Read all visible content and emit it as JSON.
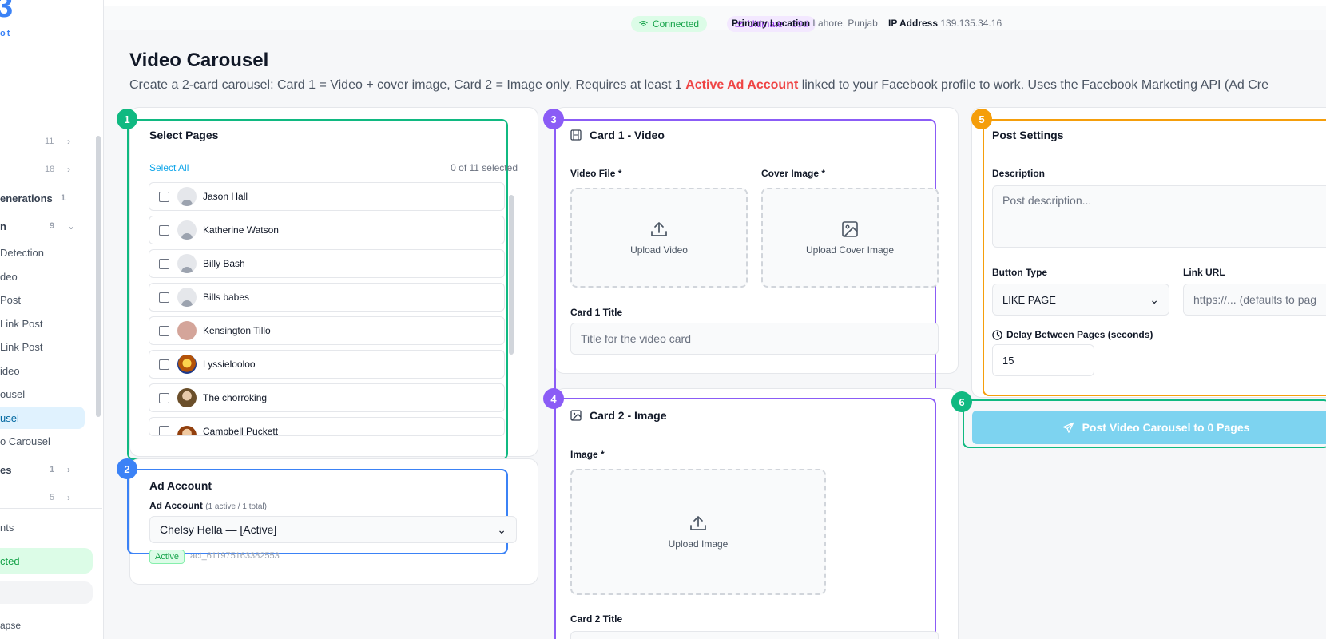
{
  "sidebar": {
    "logo_text": "ot",
    "items": [
      {
        "label": "",
        "count": "11",
        "chev": "›"
      },
      {
        "label": "",
        "count": "18",
        "chev": "›"
      },
      {
        "label": "enerations",
        "count": "1",
        "chev": ""
      },
      {
        "label": "n",
        "count": "9",
        "chev": "⌄"
      },
      {
        "label": "Detection"
      },
      {
        "label": "deo"
      },
      {
        "label": "Post"
      },
      {
        "label": "Link Post"
      },
      {
        "label": "Link Post"
      },
      {
        "label": "ideo"
      },
      {
        "label": "ousel"
      },
      {
        "label": "usel"
      },
      {
        "label": "o Carousel"
      },
      {
        "label": "es",
        "count": "1",
        "chev": "›"
      },
      {
        "label": "",
        "count": "5",
        "chev": "›"
      },
      {
        "label": "nts"
      },
      {
        "label": "cted"
      },
      {
        "label": "apse"
      }
    ]
  },
  "topbar": {
    "connected": "Connected",
    "plan": "Ultimate",
    "plan_days": "· 39d",
    "location_label": "Primary Location",
    "location_value": "Lahore, Punjab",
    "ip_label": "IP Address",
    "ip_value": "139.135.34.16"
  },
  "page": {
    "title": "Video Carousel",
    "desc_1": "Create a 2-card carousel: Card 1 = Video + cover image, Card 2 = Image only. Requires at least 1 ",
    "desc_hl": "Active Ad Account",
    "desc_2": " linked to your Facebook profile to work. Uses the Facebook Marketing API (Ad Cre"
  },
  "steps": [
    "1",
    "2",
    "3",
    "4",
    "5",
    "6"
  ],
  "select_pages": {
    "title": "Select Pages",
    "select_all": "Select All",
    "count": "0 of 11 selected",
    "pages": [
      {
        "name": "Jason Hall",
        "avatar": "default"
      },
      {
        "name": "Katherine Watson",
        "avatar": "default"
      },
      {
        "name": "Billy Bash",
        "avatar": "default"
      },
      {
        "name": "Bills babes",
        "avatar": "default"
      },
      {
        "name": "Kensington Tillo",
        "avatar": "photo",
        "color": "#d4a59a"
      },
      {
        "name": "Lyssielooloo",
        "avatar": "photo",
        "color": "#b45309"
      },
      {
        "name": "The chorroking",
        "avatar": "photo",
        "color": "#6b4f2a"
      },
      {
        "name": "Campbell Puckett",
        "avatar": "photo",
        "color": "#92400e"
      }
    ]
  },
  "ad_account": {
    "title": "Ad Account",
    "label": "Ad Account",
    "label_sub": "(1 active / 1 total)",
    "selected": "Chelsy Hella — [Active]",
    "status": "Active",
    "account_id": "act_611975163382553"
  },
  "card1": {
    "title": "Card 1 - Video",
    "video_label": "Video File *",
    "video_upload": "Upload Video",
    "cover_label": "Cover Image *",
    "cover_upload": "Upload Cover Image",
    "title_label": "Card 1 Title",
    "title_placeholder": "Title for the video card"
  },
  "card2": {
    "title": "Card 2 - Image",
    "image_label": "Image *",
    "image_upload": "Upload Image",
    "title_label": "Card 2 Title"
  },
  "post_settings": {
    "title": "Post Settings",
    "desc_label": "Description",
    "desc_placeholder": "Post description...",
    "button_type_label": "Button Type",
    "button_type_value": "LIKE PAGE",
    "link_label": "Link URL",
    "link_placeholder": "https://... (defaults to pag",
    "delay_label": "Delay Between Pages (seconds)",
    "delay_value": "15"
  },
  "post_button": "Post Video Carousel to 0 Pages",
  "colors": {
    "step1": "#10b981",
    "step2": "#3b82f6",
    "step3": "#8b5cf6",
    "step4": "#8b5cf6",
    "step5": "#f59e0b",
    "step6": "#10b981"
  }
}
